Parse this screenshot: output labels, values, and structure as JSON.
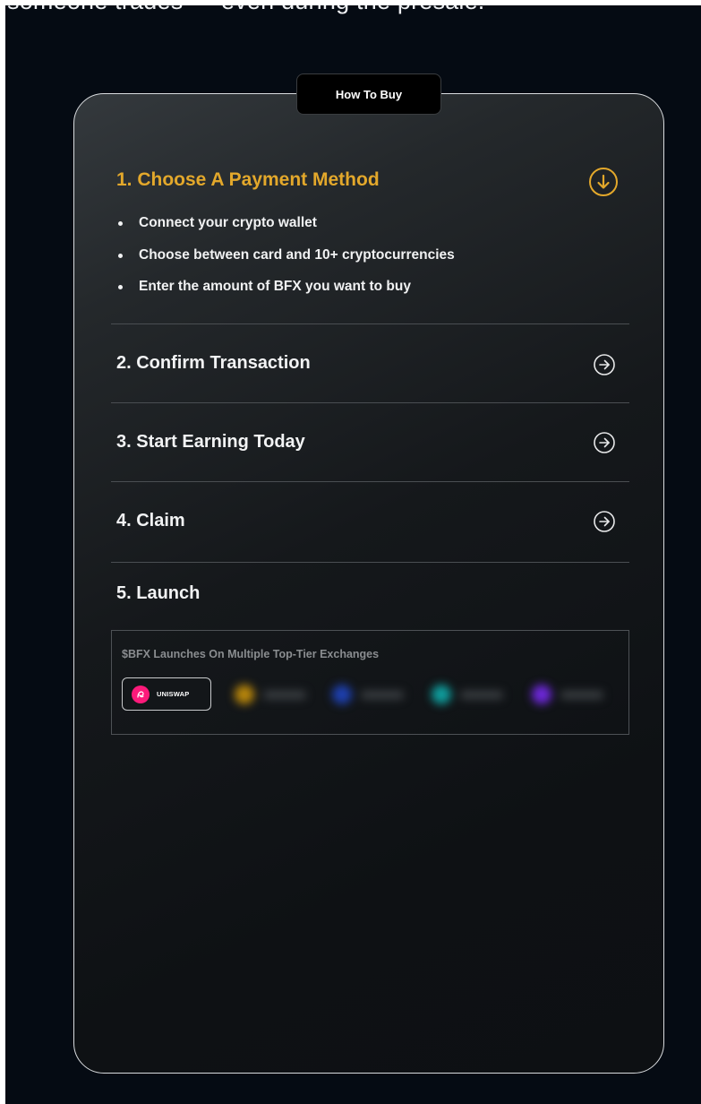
{
  "intro_text": "someone trades — even during the presale.",
  "tab_label": "How To Buy",
  "steps": [
    {
      "title": "1. Choose A Payment Method",
      "state": "expanded",
      "bullets": [
        "Connect your crypto wallet",
        "Choose between card and 10+ cryptocurrencies",
        "Enter the amount of BFX you want to buy"
      ]
    },
    {
      "title": "2. Confirm Transaction",
      "state": "collapsed"
    },
    {
      "title": "3. Start Earning Today",
      "state": "collapsed"
    },
    {
      "title": "4. Claim",
      "state": "collapsed"
    },
    {
      "title": "5. Launch",
      "state": "expanded",
      "exchanges_label": "$BFX Launches On Multiple Top-Tier Exchanges",
      "exchanges": [
        {
          "name": "UNISWAP",
          "color": "#fc1a7a",
          "blurred": false
        },
        {
          "color": "#b8860b",
          "blurred": true
        },
        {
          "color": "#1e40af",
          "blurred": true
        },
        {
          "color": "#0f9c9c",
          "blurred": true
        },
        {
          "color": "#6d28d9",
          "blurred": true
        }
      ]
    }
  ],
  "icons": {
    "expanded": "chevron-down-circle-icon",
    "collapsed": "arrow-right-circle-icon"
  },
  "colors": {
    "accent": "#e3a82b",
    "background": "#050b13",
    "card_border": "#d9dcdf"
  }
}
